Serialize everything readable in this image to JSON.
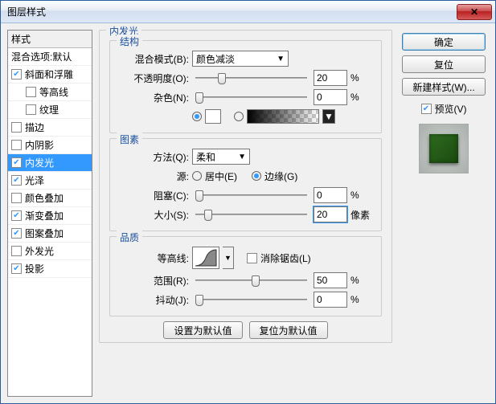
{
  "window": {
    "title": "图层样式"
  },
  "left": {
    "header": "样式",
    "blend_defaults": "混合选项:默认",
    "items": [
      {
        "label": "斜面和浮雕",
        "checked": true,
        "sub": false
      },
      {
        "label": "等高线",
        "checked": false,
        "sub": true
      },
      {
        "label": "纹理",
        "checked": false,
        "sub": true
      },
      {
        "label": "描边",
        "checked": false,
        "sub": false
      },
      {
        "label": "内阴影",
        "checked": false,
        "sub": false
      },
      {
        "label": "内发光",
        "checked": true,
        "sub": false,
        "selected": true
      },
      {
        "label": "光泽",
        "checked": true,
        "sub": false
      },
      {
        "label": "颜色叠加",
        "checked": false,
        "sub": false
      },
      {
        "label": "渐变叠加",
        "checked": true,
        "sub": false
      },
      {
        "label": "图案叠加",
        "checked": true,
        "sub": false
      },
      {
        "label": "外发光",
        "checked": false,
        "sub": false
      },
      {
        "label": "投影",
        "checked": true,
        "sub": false
      }
    ]
  },
  "panel": {
    "main_title": "内发光",
    "structure": {
      "title": "结构",
      "blend_mode_label": "混合模式(B):",
      "blend_mode_value": "颜色减淡",
      "opacity_label": "不透明度(O):",
      "opacity_value": "20",
      "opacity_unit": "%",
      "noise_label": "杂色(N):",
      "noise_value": "0",
      "noise_unit": "%",
      "color_selected": true,
      "gradient_selected": false
    },
    "elements": {
      "title": "图素",
      "technique_label": "方法(Q):",
      "technique_value": "柔和",
      "source_label": "源:",
      "center_label": "居中(E)",
      "edge_label": "边缘(G)",
      "center_selected": false,
      "edge_selected": true,
      "choke_label": "阻塞(C):",
      "choke_value": "0",
      "choke_unit": "%",
      "size_label": "大小(S):",
      "size_value": "20",
      "size_unit": "像素"
    },
    "quality": {
      "title": "品质",
      "contour_label": "等高线:",
      "antialias_label": "消除锯齿(L)",
      "antialias_checked": false,
      "range_label": "范围(R):",
      "range_value": "50",
      "range_unit": "%",
      "jitter_label": "抖动(J):",
      "jitter_value": "0",
      "jitter_unit": "%"
    },
    "set_default": "设置为默认值",
    "reset_default": "复位为默认值"
  },
  "right": {
    "ok": "确定",
    "cancel": "复位",
    "new_style": "新建样式(W)...",
    "preview_label": "预览(V)",
    "preview_checked": true
  }
}
